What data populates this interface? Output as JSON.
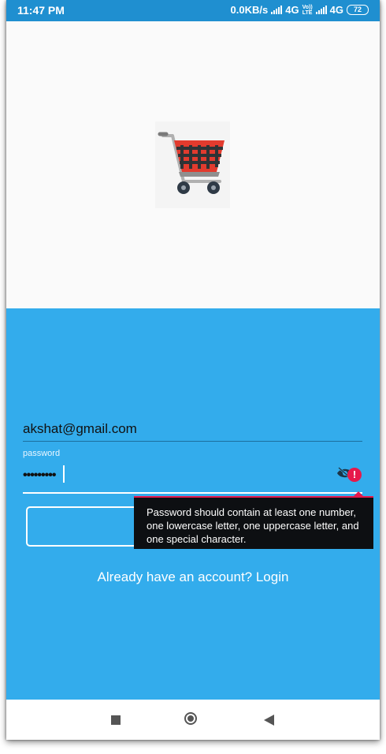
{
  "status_bar": {
    "time": "11:47 PM",
    "network_speed": "0.0KB/s",
    "network_type_1": "4G",
    "volte_top": "Vo))",
    "volte_bottom": "LTE",
    "network_type_2": "4G",
    "battery": "72"
  },
  "logo": {
    "icon": "shopping-cart-icon"
  },
  "form": {
    "email_value": "akshat@gmail.com",
    "password_label": "password",
    "password_value": "•••••••••",
    "toggle_icon": "eye-off-icon",
    "error_icon": "error-icon",
    "error_icon_glyph": "!",
    "error_tooltip": "Password should contain at least one number, one lowercase letter, one uppercase letter, and one special character.",
    "login_link": "Already have an account? Login"
  },
  "nav_bar": {
    "recents_icon": "square-icon",
    "home_icon": "circle-icon",
    "back_icon": "triangle-back-icon"
  },
  "colors": {
    "status_bar": "#1f8fd0",
    "background_blue": "#33acec",
    "error": "#e6194b",
    "tooltip": "#0d0f12"
  }
}
